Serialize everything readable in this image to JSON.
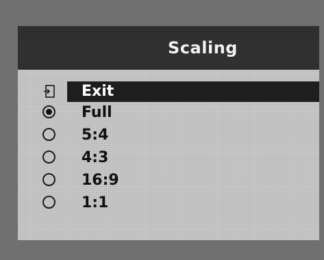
{
  "osd": {
    "title": "Scaling",
    "items": [
      {
        "label": "Exit",
        "icon": "exit-icon",
        "selected": true
      },
      {
        "label": "Full",
        "icon": "radio-checked-icon",
        "checked": true
      },
      {
        "label": "5:4",
        "icon": "radio-unchecked-icon",
        "checked": false
      },
      {
        "label": "4:3",
        "icon": "radio-unchecked-icon",
        "checked": false
      },
      {
        "label": "16:9",
        "icon": "radio-unchecked-icon",
        "checked": false
      },
      {
        "label": "1:1",
        "icon": "radio-unchecked-icon",
        "checked": false
      }
    ]
  },
  "colors": {
    "bezel": "#707070",
    "panel": "#c9c9c9",
    "header": "#2c2c2c",
    "highlight": "#1e1e1e"
  }
}
